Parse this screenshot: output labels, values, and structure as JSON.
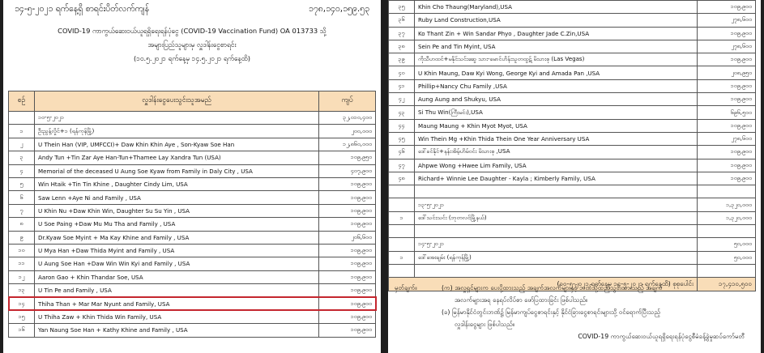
{
  "left": {
    "date_line": "၁၄-၅-၂၀၂၁ ရက်နေ့ရှိ စာရင်းပိတ်လက်ကျန်",
    "balance": "၁၇၈,၁၄၀,၁၅၉.၅၃",
    "title1": "COVID-19 ကာကွယ်ဆေးဝယ်ယူရရှိရေးရန်ပုံငွေ (COVID-19 Vaccination Fund) OA 013733 သို့",
    "title2": "အများပြည်သူများမှ လှူဒါန်းငွေစာရင်း",
    "title3": "(၁၀.၅.၂၀၂၁ ရက်နေ့မှ ၁၄.၅.၂၀၂၁ ရက်နေ့ထိ)",
    "headers": [
      "စဉ်",
      "လှူဒါန်းငွေပေးသွင်းသူအမည်",
      "ကျပ်"
    ],
    "rows": [
      {
        "no": "",
        "name": "၁၀-၅-၂၀၂၁",
        "amt": "၃၂,၀၁၀,၄၀၀"
      },
      {
        "no": "၁",
        "name": "ဦးညွန့်လှိုင်+၁ (ရန်ကုန်မြို့)",
        "amt": "၂၀၀,၀၀၀"
      },
      {
        "no": "၂",
        "name": "U Thein Han (VIP, UMFCCI)+ Daw Khin Khin Aye , Son-Kyaw Soe Han",
        "amt": "၁၂,၈၆၀,၀၀၀"
      },
      {
        "no": "၃",
        "name": "Andy Tun +Tin Zar Aye Han-Tun+Thamee Lay Xandra Tun (USA)",
        "amt": "၁၀၉,၉၅၀"
      },
      {
        "no": "၄",
        "name": "Memorial of the deceased U Aung Soe Kyaw from Family in Daly City , USA",
        "amt": "၄၀၇,၉၀၀"
      },
      {
        "no": "၅",
        "name": "Win Htaik +Tin Tin Khine , Daughter Cindy Lim, USA",
        "amt": "၁၀၉,၉၀၀"
      },
      {
        "no": "၆",
        "name": "Saw Lenn +Aye Ni and Family , USA",
        "amt": "၁၀၉,၉၀၀"
      },
      {
        "no": "၇",
        "name": "U Khin Nu +Daw Khin Win, Daughter Su Su Yin , USA",
        "amt": "၁၀၉,၉၀၀"
      },
      {
        "no": "၈",
        "name": "U Soe Paing +Daw Mu Mu Tha and Family , USA",
        "amt": "၁၀၉,၉၀၀"
      },
      {
        "no": "၉",
        "name": "Dr.Kyaw Soe Myint + Ma Kay Khine and Family , USA",
        "amt": "၂၀၆,၆၀၀"
      },
      {
        "no": "၁၀",
        "name": "U Mya Han +Daw Thida Myint and Family , USA",
        "amt": "၁၀၉,၉၀၀"
      },
      {
        "no": "၁၁",
        "name": "U Aung Soe Han +Daw Win Win Kyi and Family , USA",
        "amt": "၁၀၉,၉၀၀"
      },
      {
        "no": "၁၂",
        "name": "Aaron Gao + Khin Thandar Soe, USA",
        "amt": "၁၀၉,၉၀၀"
      },
      {
        "no": "၁၃",
        "name": "U Tin Pe and Family , USA",
        "amt": "၁၀၉,၉၀၀"
      },
      {
        "no": "၁၄",
        "name": "Thiha Than + Mar Mar Nyunt and Family, USA",
        "amt": "၁၀၉,၉၀၀"
      },
      {
        "no": "၁၅",
        "name": "U Thiha Zaw + Khin Thida Win Family, USA",
        "amt": "၁၀၉,၉၀၀"
      },
      {
        "no": "၁၆",
        "name": "Yan Naung Soe Han + Kathy Khine and Family , USA",
        "amt": "၁၀၉,၉၀၀"
      }
    ]
  },
  "right": {
    "rows": [
      {
        "no": "၃၅",
        "name": "Khin Cho Thaung(Maryland),USA",
        "amt": "၁၀၉,၉၀၀"
      },
      {
        "no": "၃၆",
        "name": "Ruby Land Construction,USA",
        "amt": "၂၇၈,၆၀၀"
      },
      {
        "no": "၃၇",
        "name": "Ko Thant Zin + Win Sandar Phyo , Daughter Jade C.Zin,USA",
        "amt": "၁၀၉,၉၀၀"
      },
      {
        "no": "၃၈",
        "name": "Sein Pe and Tin Myint, USA",
        "amt": "၂၇၈,၆၀၀"
      },
      {
        "no": "၃၉",
        "name": "ကိုသီဟထင်+မနိုင်သင်းဆွေ သား-မောင်ဟိန်းသူတထွဋ် မိသားစု (Las Vegas)",
        "amt": "၁၀၉,၉၀၀"
      },
      {
        "no": "၄၀",
        "name": "U Khin Maung, Daw Kyi Wong, George Kyi and Amada Pan ,USA",
        "amt": "၂၀၈,၉၅၀"
      },
      {
        "no": "၄၁",
        "name": "Phillip+Nancy Chu Family ,USA",
        "amt": "၁၀၉,၉၀၀"
      },
      {
        "no": "၄၂",
        "name": "Aung Aung and Shukyu, USA",
        "amt": "၁၀၉,၉၀၀"
      },
      {
        "no": "၄၃",
        "name": "Si Thu Win(ကြီးမင်း),USA",
        "amt": "၆၉၆,၅၀၀"
      },
      {
        "no": "၄၄",
        "name": "Maung Maung + Khin Myot Myot, USA",
        "amt": "၁၀၉,၉၀၀"
      },
      {
        "no": "၄၅",
        "name": "Win Thein Mg +Khin Thida Thein One Year Anniversary USA",
        "amt": "၂၇၈,၆၀၀"
      },
      {
        "no": "၄၆",
        "name": "ဒေါ်ခင်နိုင်+နန်းအိမ့်ဟိမ်ဝင်း မိသားစု ,USA",
        "amt": "၁၀၉,၉၀၀"
      },
      {
        "no": "၄၇",
        "name": "Ahpwe Wong +Hwee Lim Family, USA",
        "amt": "၁၀၉,၉၀၀"
      },
      {
        "no": "၄၈",
        "name": "Richard+ Winnie Lee Daughter - Kayla ; Kimberly Family, USA",
        "amt": "၁၀၉,၉၀၀"
      }
    ],
    "section2": [
      {
        "no": "",
        "name": "၁၃-၅-၂၀၂၁",
        "amt": "၁,၃၂၀,၀၀၀"
      },
      {
        "no": "၁",
        "name": "ဒေါ်သင်းသင်း (ဘုတလင်မြို့နယ်)",
        "amt": "၁,၃၂၀,၀၀၀"
      }
    ],
    "section3": [
      {
        "no": "",
        "name": "၁၄-၅-၂၀၂၁",
        "amt": "၅၀,၀၀၀"
      },
      {
        "no": "၁",
        "name": "ဒေါ်အေးချမ်း (ရန်ကုန်မြို့)",
        "amt": "၅၀,၀၀၀"
      }
    ],
    "total_label": "(၁၀-၅-၂၀၂၁ ရက်နေ့မှ ၁၄-၅-၂၀၂၁ ရက်နေ့ထိ) စုစုပေါင်း",
    "total_amt": "၁၇,၄၁၀,၅၀၀",
    "note_label": "မှတ်ချက်။",
    "note1": "(က) အလှူရှင်များက ပေးပို့ထားသည့် အချက်အလက်များနှင့် ဘဏ်သို့ထည့်သွင်းထားသည့် အချက်",
    "note1b": "အလက်များအရ နေရပ်လိပ်စာ ဖော်ပြထားခြင်း ဖြစ်ပါသည်။",
    "note2": "(ခ) မြန်မာနိုင်ငံတွင်းဘဏ်၌ မြန်မာကျပ်ငွေစာရင်းနှင့် နိုင်ငံခြားငွေစာရင်းများသို့ ဝင်ရောက်ပြီးသည့်",
    "note2b": "လှူဒါန်းငွေများ ဖြစ်ပါသည်။",
    "footer": "COVID-19 ကာကွယ်ဆေးဝယ်ယူရရှိရေးရန်ပုံငွေစီမံခန့်ခွဲမှုဆပ်ကော်မတီ"
  }
}
